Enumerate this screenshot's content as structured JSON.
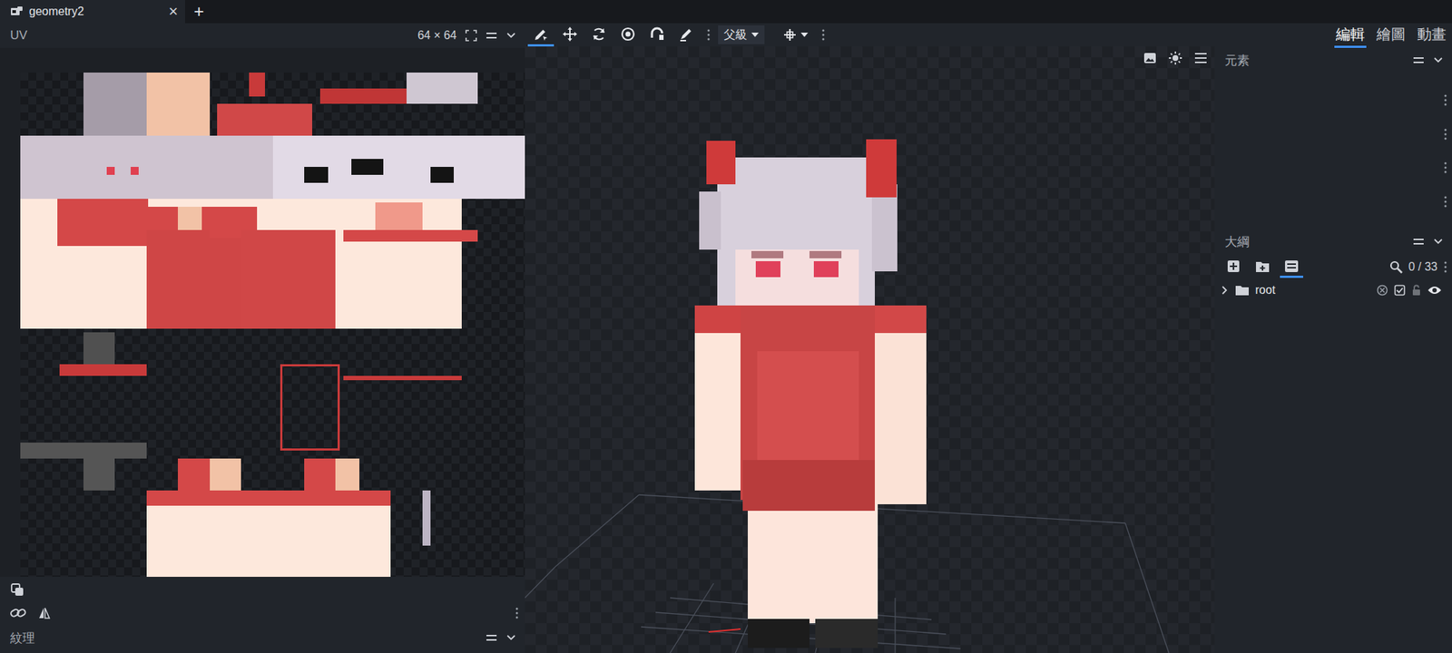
{
  "window": {
    "tab": {
      "title": "geometry2",
      "close": "×"
    },
    "add_tab": "+"
  },
  "uv_panel": {
    "title": "UV",
    "size": "64 × 64"
  },
  "toolbar": {
    "tools": [
      {
        "selected": true
      },
      {
        "selected": false
      },
      {
        "selected": false
      },
      {
        "selected": false
      },
      {
        "selected": false
      },
      {
        "selected": false
      }
    ],
    "parent_dropdown": {
      "label": "父級"
    }
  },
  "mode_tabs": [
    {
      "label": "編輯",
      "selected": true
    },
    {
      "label": "繪圖",
      "selected": false
    },
    {
      "label": "動畫",
      "selected": false
    }
  ],
  "element_panel": {
    "title": "元素"
  },
  "outliner": {
    "title": "大綱",
    "count": "0 / 33",
    "tools": [
      {
        "selected": false
      },
      {
        "selected": false
      },
      {
        "selected": true
      }
    ],
    "items": [
      {
        "name": "root",
        "expanded": false,
        "exported": true,
        "locked": false,
        "visible": true
      }
    ]
  },
  "texture_panel": {
    "title": "紋理"
  }
}
